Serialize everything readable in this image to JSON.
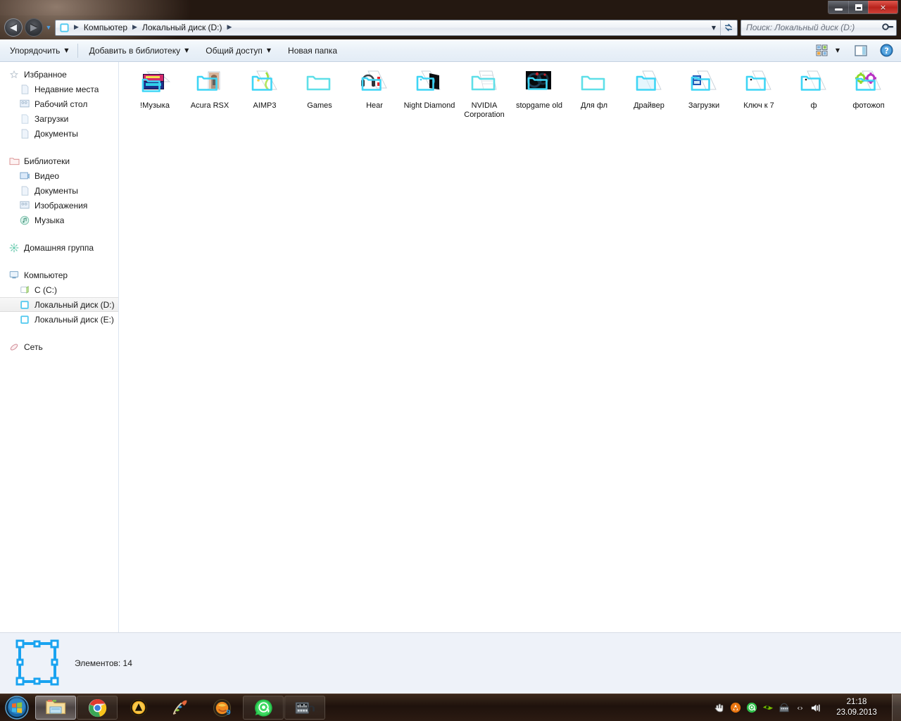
{
  "window": {
    "controls": {
      "minimize": "minimize-button",
      "maximize": "maximize-button",
      "close": "×"
    }
  },
  "address": {
    "back_label": "◀",
    "forward_label": "▶",
    "history_caret": "▼",
    "breadcrumb": [
      {
        "label": "Компьютер"
      },
      {
        "label": "Локальный диск (D:)"
      }
    ],
    "dropdown_caret": "▼",
    "refresh_glyph": "⇄",
    "separator": "▶"
  },
  "search": {
    "placeholder": "Поиск: Локальный диск (D:)",
    "value": "",
    "icon": "search-icon"
  },
  "toolbar": {
    "items": [
      {
        "label": "Упорядочить",
        "has_caret": true
      },
      {
        "label": "Добавить в библиотеку",
        "has_caret": true
      },
      {
        "label": "Общий доступ",
        "has_caret": true
      },
      {
        "label": "Новая папка",
        "has_caret": false
      }
    ],
    "right_icons": [
      {
        "name": "view-options-icon"
      },
      {
        "name": "view-dropdown-caret",
        "glyph": "▼"
      },
      {
        "name": "preview-pane-icon"
      },
      {
        "name": "help-icon",
        "glyph": "?"
      }
    ]
  },
  "sidebar": {
    "groups": [
      {
        "header": {
          "label": "Избранное",
          "icon": "favorites-star-icon"
        },
        "items": [
          {
            "label": "Недавние места",
            "icon": "recent-places-icon"
          },
          {
            "label": "Рабочий стол",
            "icon": "desktop-icon"
          },
          {
            "label": "Загрузки",
            "icon": "downloads-icon"
          },
          {
            "label": "Документы",
            "icon": "documents-icon"
          }
        ]
      },
      {
        "header": {
          "label": "Библиотеки",
          "icon": "libraries-icon"
        },
        "items": [
          {
            "label": "Видео",
            "icon": "video-library-icon"
          },
          {
            "label": "Документы",
            "icon": "documents-library-icon"
          },
          {
            "label": "Изображения",
            "icon": "pictures-library-icon"
          },
          {
            "label": "Музыка",
            "icon": "music-library-icon"
          }
        ]
      },
      {
        "header": {
          "label": "Домашняя группа",
          "icon": "homegroup-icon"
        },
        "items": []
      },
      {
        "header": {
          "label": "Компьютер",
          "icon": "computer-icon"
        },
        "items": [
          {
            "label": "C (C:)",
            "icon": "system-drive-icon",
            "selected": false
          },
          {
            "label": "Локальный диск (D:)",
            "icon": "local-drive-icon",
            "selected": true
          },
          {
            "label": "Локальный диск (E:)",
            "icon": "local-drive-icon",
            "selected": false
          }
        ]
      },
      {
        "header": {
          "label": "Сеть",
          "icon": "network-icon"
        },
        "items": []
      }
    ]
  },
  "files": [
    {
      "name": "!Музыка",
      "icon": "folder-with-music-thumbnail"
    },
    {
      "name": "Acura RSX",
      "icon": "folder-with-photo-thumbnail"
    },
    {
      "name": "AIMP3",
      "icon": "folder-with-aimp-thumbnail"
    },
    {
      "name": "Games",
      "icon": "folder-empty"
    },
    {
      "name": "Hear",
      "icon": "folder-with-headphones-thumbnail"
    },
    {
      "name": "Night Diamond",
      "icon": "folder-with-dark-thumbnail"
    },
    {
      "name": "NVIDIA Corporation",
      "icon": "folder-with-documents"
    },
    {
      "name": "stopgame old",
      "icon": "folder-with-dark-art-thumbnail"
    },
    {
      "name": "Для фл",
      "icon": "folder-empty"
    },
    {
      "name": "Драйвер",
      "icon": "folder-light"
    },
    {
      "name": "Загрузки",
      "icon": "folder-with-blue-thumbnail"
    },
    {
      "name": "Ключ к 7",
      "icon": "folder-light"
    },
    {
      "name": "ф",
      "icon": "folder-light"
    },
    {
      "name": "фотожоп",
      "icon": "folder-with-photoshop-thumbnail"
    }
  ],
  "status": {
    "text": "Элементов: 14",
    "drive_icon": "local-drive-large-icon"
  },
  "taskbar": {
    "start": "start-orb-icon",
    "buttons": [
      {
        "name": "explorer-taskbar-button",
        "icon": "folder-icon",
        "state": "active"
      },
      {
        "name": "chrome-taskbar-button",
        "icon": "chrome-icon",
        "state": "running"
      },
      {
        "name": "aimp-taskbar-button",
        "icon": "aimp-icon",
        "state": "none"
      },
      {
        "name": "paint-taskbar-button",
        "icon": "brush-icon",
        "state": "none"
      },
      {
        "name": "flstudio-taskbar-button",
        "icon": "fl-studio-icon",
        "state": "none"
      },
      {
        "name": "icq-taskbar-button",
        "icon": "icq-icon",
        "state": "running"
      },
      {
        "name": "audio-taskbar-button",
        "icon": "equalizer-icon",
        "state": "running"
      }
    ],
    "tray": [
      {
        "name": "tray-hand-icon"
      },
      {
        "name": "tray-aimp-icon"
      },
      {
        "name": "tray-icq-icon"
      },
      {
        "name": "tray-nvidia-icon"
      },
      {
        "name": "tray-app-icon"
      },
      {
        "name": "tray-expand-icon",
        "glyph": "‹›"
      },
      {
        "name": "tray-volume-icon"
      }
    ],
    "clock": {
      "time": "21:18",
      "date": "23.09.2013"
    }
  },
  "colors": {
    "folder_cyan": "#3fd5f5",
    "accent_blue": "#2a8fd4",
    "status_bg": "#eef2f9"
  }
}
